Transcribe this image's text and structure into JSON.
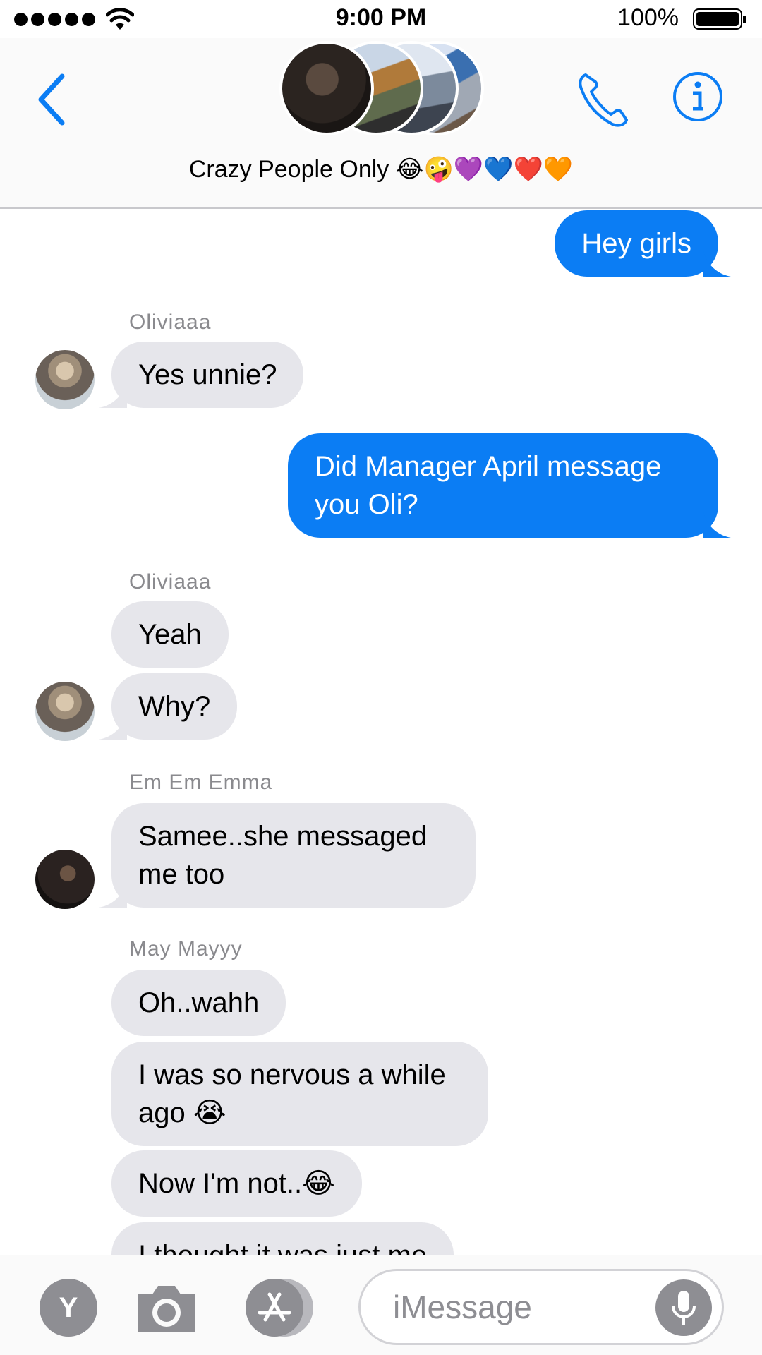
{
  "status_bar": {
    "time": "9:00 PM",
    "battery": "100%",
    "signal_icon": "signal-dots-icon",
    "wifi_icon": "wifi-icon"
  },
  "header": {
    "back_icon": "chevron-left-icon",
    "group_name": "Crazy People Only 😂🤪💜💙❤️🧡",
    "call_icon": "phone-icon",
    "info_icon": "info-icon",
    "accent_color": "#0b7df4"
  },
  "messages": [
    {
      "direction": "out",
      "text": "Hey girls"
    },
    {
      "direction": "in",
      "sender": "Oliviaaa",
      "text": "Yes unnie?"
    },
    {
      "direction": "out",
      "text_lines": [
        "Did Manager April message",
        "you Oli?"
      ]
    },
    {
      "direction": "in",
      "sender": "Oliviaaa",
      "text": "Yeah"
    },
    {
      "direction": "in",
      "text": "Why?"
    },
    {
      "direction": "in",
      "sender": "Em Em Emma",
      "text_lines": [
        "Samee..she messaged",
        "me too"
      ]
    },
    {
      "direction": "in",
      "sender": "May Mayyy",
      "text": "Oh..wahh"
    },
    {
      "direction": "in",
      "text_lines": [
        "I was so nervous a while",
        "ago 😭"
      ]
    },
    {
      "direction": "in",
      "text": "Now I'm not..😂"
    },
    {
      "direction": "in",
      "text": "I thought it was just me"
    }
  ],
  "input_bar": {
    "app_button_label": "Y",
    "camera_icon": "camera-icon",
    "app_store_icon": "app-store-icon",
    "placeholder": "iMessage",
    "mic_icon": "microphone-icon"
  }
}
